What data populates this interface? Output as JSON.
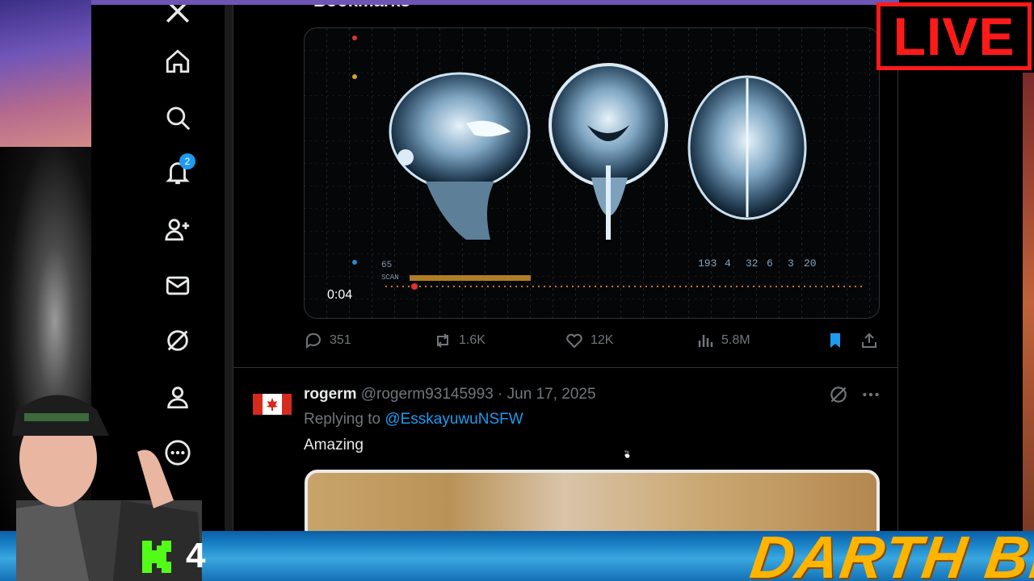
{
  "page": {
    "title": "Bookmarks"
  },
  "sidebar": {
    "items": [
      {
        "name": "x-logo"
      },
      {
        "name": "home"
      },
      {
        "name": "explore"
      },
      {
        "name": "notifications",
        "badge": "2"
      },
      {
        "name": "follow"
      },
      {
        "name": "messages"
      },
      {
        "name": "grok"
      },
      {
        "name": "profile"
      },
      {
        "name": "more"
      }
    ]
  },
  "video": {
    "time": "0:04",
    "overlay_text": {
      "scan": "SCAN",
      "n65": "65",
      "numbers": [
        "193",
        "4",
        "32",
        "6",
        "3",
        "20"
      ]
    }
  },
  "actions": {
    "replies": "351",
    "reposts": "1.6K",
    "likes": "12K",
    "views": "5.8M"
  },
  "reply": {
    "name": "rogerm",
    "handle": "@rogerm93145993",
    "sep": "·",
    "date": "Jun 17, 2025",
    "replying_prefix": "Replying to",
    "replying_to": "@EsskayuwuNSFW",
    "text": "Amazing"
  },
  "overlay": {
    "live": "LIVE",
    "kick_count": "4",
    "brand": "DARTH BLAZE"
  },
  "colors": {
    "accent": "#1d9bf0",
    "live": "#ff1a1a",
    "brand": "#ffb400",
    "kick": "#53fc18"
  }
}
